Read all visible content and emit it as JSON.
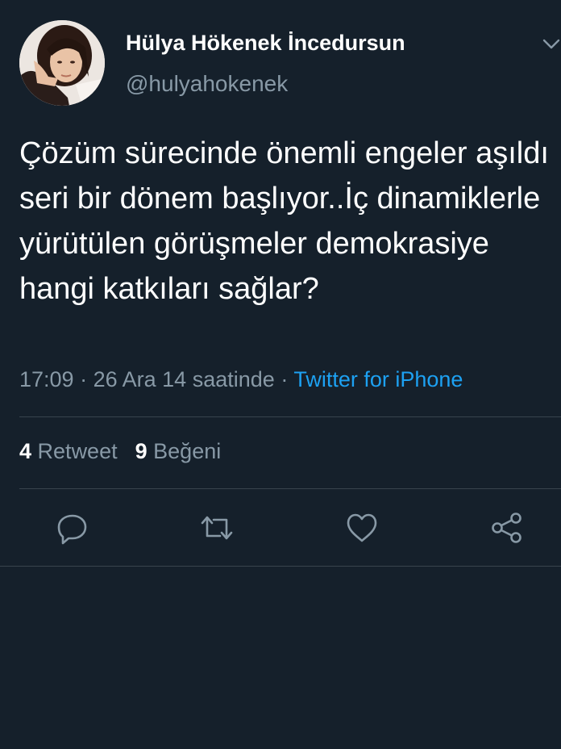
{
  "author": {
    "display_name": "Hülya Hökenek İncedursun",
    "handle": "@hulyahokenek"
  },
  "tweet": {
    "text": "Çözüm sürecinde önemli engeler aşıldı seri bir dönem başlıyor..İç dinamiklerle yürütülen görüşmeler demokrasiye hangi katkıları sağlar?",
    "time": "17:09",
    "date": "26 Ara 14 saatinde",
    "separator": "·",
    "source": "Twitter for iPhone"
  },
  "stats": {
    "retweet_count": "4",
    "retweet_label": "Retweet",
    "like_count": "9",
    "like_label": "Beğeni"
  },
  "icons": {
    "reply": "reply-icon",
    "retweet": "retweet-icon",
    "like": "heart-icon",
    "share": "share-icon",
    "more": "chevron-down-icon"
  },
  "colors": {
    "background": "#15202b",
    "secondary_text": "#8899a6",
    "link": "#1da1f2",
    "divider": "#38444d"
  }
}
